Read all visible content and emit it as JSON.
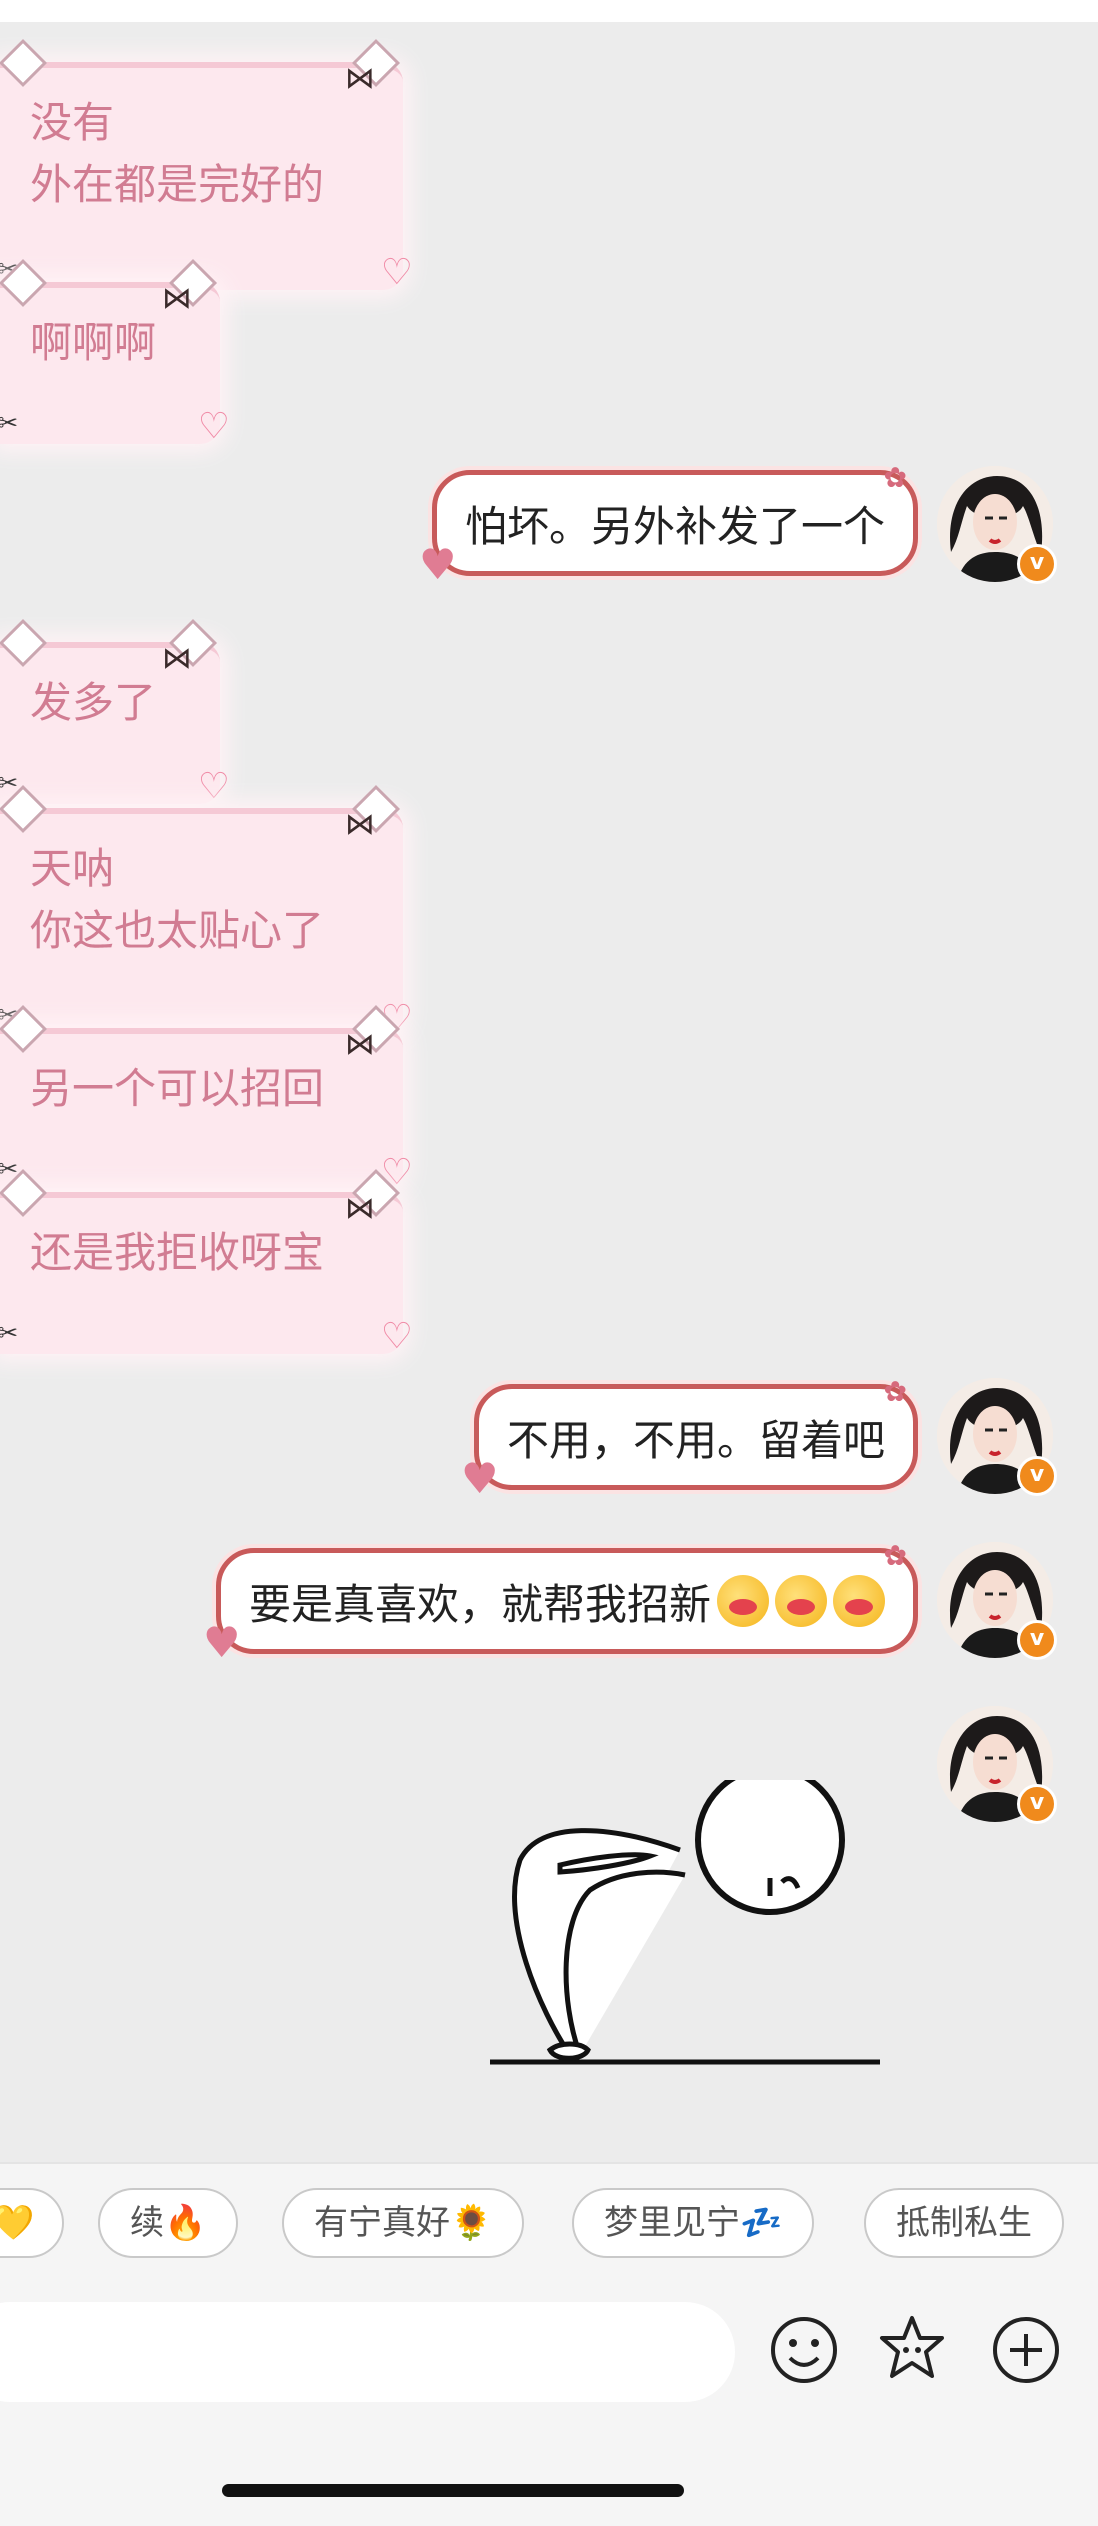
{
  "messages": [
    {
      "side": "in",
      "lines": [
        "没有",
        "外在都是完好的"
      ]
    },
    {
      "side": "in",
      "lines": [
        "啊啊啊"
      ]
    },
    {
      "side": "out",
      "text": "怕坏。另外补发了一个"
    },
    {
      "side": "in",
      "lines": [
        "发多了"
      ]
    },
    {
      "side": "in",
      "lines": [
        "天呐",
        "你这也太贴心了"
      ]
    },
    {
      "side": "in",
      "lines": [
        "另一个可以招回"
      ]
    },
    {
      "side": "in",
      "lines": [
        "还是我拒收呀宝"
      ]
    },
    {
      "side": "out",
      "text": "不用，不用。留着吧"
    },
    {
      "side": "out",
      "text": "要是真喜欢，就帮我招新",
      "emoji_count": 3
    }
  ],
  "quick_replies": [
    "💛",
    "续🔥",
    "有宁真好🌻",
    "梦里见宁💤",
    "抵制私生"
  ],
  "colors": {
    "chat_bg": "#ececec",
    "incoming_text": "#d17c92",
    "incoming_bg": "#fde8ee",
    "outgoing_border": "#c85a5a",
    "verified_badge": "#f08a1c"
  },
  "icons": {
    "emoji_button": "smiley-icon",
    "sticker_button": "flower-face-icon",
    "more_button": "plus-circle-icon",
    "verified": "v-badge-icon"
  },
  "verified_glyph": "v"
}
